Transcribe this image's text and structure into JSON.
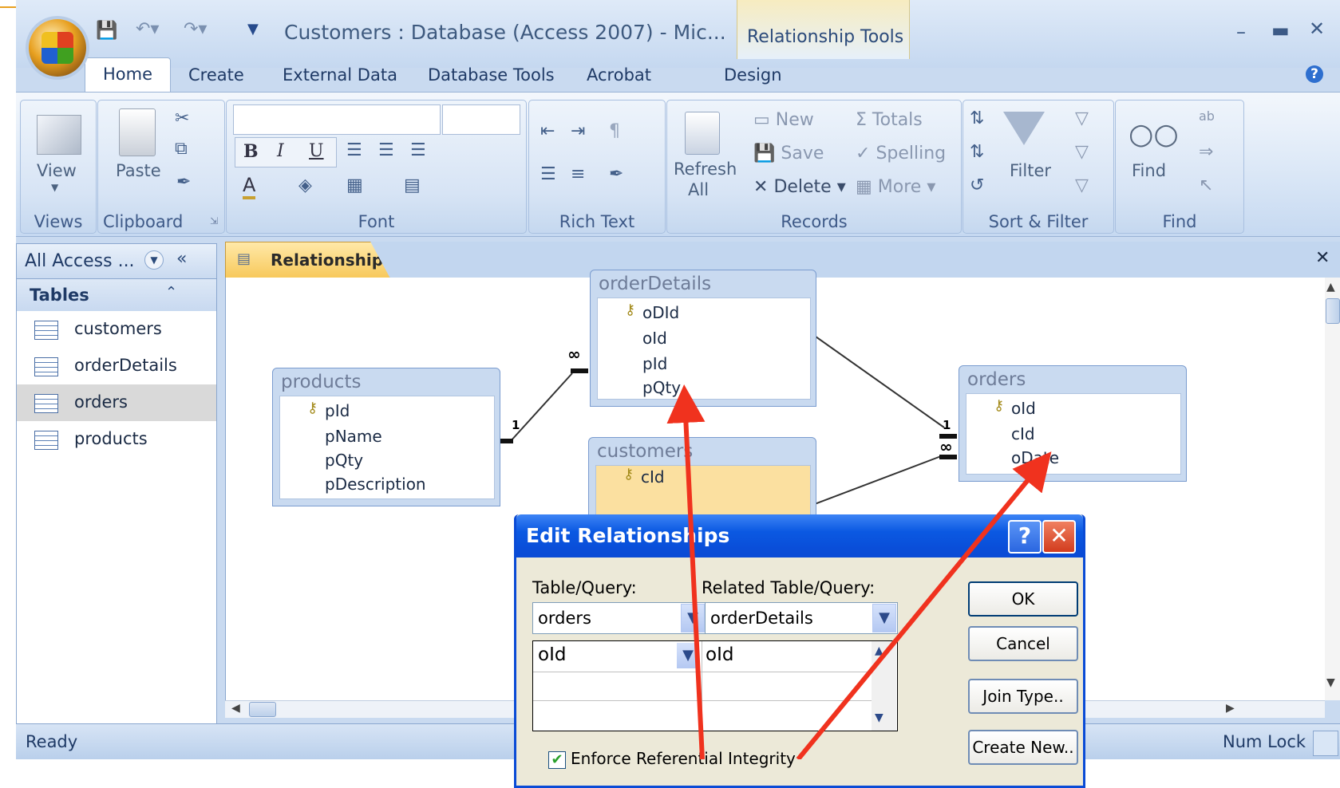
{
  "window": {
    "title": "Customers : Database (Access 2007) - Mic...",
    "context_group": "Relationship Tools",
    "context_tab": "Design"
  },
  "tabs": [
    "Home",
    "Create",
    "External Data",
    "Database Tools",
    "Acrobat"
  ],
  "ribbon": {
    "views": {
      "view_label": "View",
      "group": "Views"
    },
    "clipboard": {
      "paste_label": "Paste",
      "group": "Clipboard"
    },
    "font": {
      "bold": "B",
      "italic": "I",
      "underline": "U",
      "font_color": "A",
      "group": "Font"
    },
    "rich_text": {
      "group": "Rich Text"
    },
    "records": {
      "refresh": "Refresh",
      "refresh_sub": "All",
      "new": "New",
      "save": "Save",
      "delete": "Delete",
      "totals": "Totals",
      "spelling": "Spelling",
      "more": "More",
      "group": "Records"
    },
    "sort_filter": {
      "filter": "Filter",
      "group": "Sort & Filter"
    },
    "find": {
      "find": "Find",
      "group": "Find"
    }
  },
  "nav": {
    "header": "All Access ...",
    "section": "Tables",
    "items": [
      "customers",
      "orderDetails",
      "orders",
      "products"
    ],
    "selected": "orders"
  },
  "doc_tab": "Relationships",
  "tables": {
    "orderDetails": {
      "title": "orderDetails",
      "fields": [
        "oDId",
        "oId",
        "pId",
        "pQty"
      ]
    },
    "products": {
      "title": "products",
      "fields": [
        "pId",
        "pName",
        "pQty",
        "pDescription"
      ]
    },
    "orders": {
      "title": "orders",
      "fields": [
        "oId",
        "cId",
        "oDate"
      ]
    },
    "customers": {
      "title": "customers",
      "fields": [
        "cId"
      ]
    }
  },
  "relation_labels": {
    "one": "1",
    "many": "∞"
  },
  "status": {
    "left": "Ready",
    "right": "Num Lock"
  },
  "dialog": {
    "title": "Edit Relationships",
    "table_query_label": "Table/Query:",
    "related_label": "Related Table/Query:",
    "table": "orders",
    "related_table": "orderDetails",
    "field_left": "oId",
    "field_right": "oId",
    "ok": "OK",
    "cancel": "Cancel",
    "join_type": "Join Type..",
    "create_new": "Create New..",
    "enforce": "Enforce Referential Integrity"
  },
  "colors": {
    "arrow": "#f0321e",
    "dialog_title": "#0a4bd6",
    "ribbon": "#c9daf0"
  }
}
